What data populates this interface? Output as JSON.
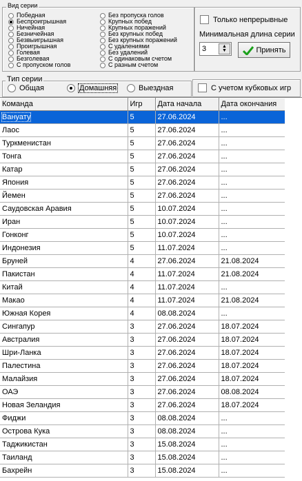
{
  "series_type": {
    "legend": "Вид серии",
    "options_left": [
      "Победная",
      "Беспроигрышная",
      "Ничейная",
      "Безничейная",
      "Безвыигрышная",
      "Проигрышная",
      "Голевая",
      "Безголевая",
      "С пропуском голов"
    ],
    "options_right": [
      "Без пропуска голов",
      "Крупных побед",
      "Крупных поражений",
      "Без крупных побед",
      "Без крупных поражений",
      "С удалениями",
      "Без удалений",
      "С одинаковым счетом",
      "С разным счетом"
    ],
    "selected": "Беспроигрышная"
  },
  "continuous_label": "Только непрерывные",
  "min_length_label": "Минимальная длина серии",
  "min_length_value": "3",
  "accept_label": "Принять",
  "game_type": {
    "legend": "Тип серии",
    "options": [
      "Общая",
      "Домашняя",
      "Выездная"
    ],
    "selected": "Домашняя"
  },
  "cup_games_label": "С учетом кубковых игр",
  "table": {
    "headers": [
      "Команда",
      "Игр",
      "Дата начала",
      "Дата окончания"
    ],
    "rows": [
      [
        "Вануату",
        "5",
        "27.06.2024",
        "..."
      ],
      [
        "Лаос",
        "5",
        "27.06.2024",
        "..."
      ],
      [
        "Туркменистан",
        "5",
        "27.06.2024",
        "..."
      ],
      [
        "Тонга",
        "5",
        "27.06.2024",
        "..."
      ],
      [
        "Катар",
        "5",
        "27.06.2024",
        "..."
      ],
      [
        "Япония",
        "5",
        "27.06.2024",
        "..."
      ],
      [
        "Йемен",
        "5",
        "27.06.2024",
        "..."
      ],
      [
        "Саудовская Аравия",
        "5",
        "10.07.2024",
        "..."
      ],
      [
        "Иран",
        "5",
        "10.07.2024",
        "..."
      ],
      [
        "Гонконг",
        "5",
        "10.07.2024",
        "..."
      ],
      [
        "Индонезия",
        "5",
        "11.07.2024",
        "..."
      ],
      [
        "Бруней",
        "4",
        "27.06.2024",
        "21.08.2024"
      ],
      [
        "Пакистан",
        "4",
        "11.07.2024",
        "21.08.2024"
      ],
      [
        "Китай",
        "4",
        "11.07.2024",
        "..."
      ],
      [
        "Макао",
        "4",
        "11.07.2024",
        "21.08.2024"
      ],
      [
        "Южная Корея",
        "4",
        "08.08.2024",
        "..."
      ],
      [
        "Сингапур",
        "3",
        "27.06.2024",
        "18.07.2024"
      ],
      [
        "Австралия",
        "3",
        "27.06.2024",
        "18.07.2024"
      ],
      [
        "Шри-Ланка",
        "3",
        "27.06.2024",
        "18.07.2024"
      ],
      [
        "Палестина",
        "3",
        "27.06.2024",
        "18.07.2024"
      ],
      [
        "Малайзия",
        "3",
        "27.06.2024",
        "18.07.2024"
      ],
      [
        "ОАЭ",
        "3",
        "27.06.2024",
        "08.08.2024"
      ],
      [
        "Новая Зеландия",
        "3",
        "27.06.2024",
        "18.07.2024"
      ],
      [
        "Фиджи",
        "3",
        "08.08.2024",
        "..."
      ],
      [
        "Острова Кука",
        "3",
        "08.08.2024",
        "..."
      ],
      [
        "Таджикистан",
        "3",
        "15.08.2024",
        "..."
      ],
      [
        "Таиланд",
        "3",
        "15.08.2024",
        "..."
      ],
      [
        "Бахрейн",
        "3",
        "15.08.2024",
        "..."
      ]
    ],
    "selected_row": 0
  },
  "colors": {
    "selection": "#0a64d8",
    "accept_check": "#1aa01a"
  },
  "icons": {
    "accept": "checkmark-icon",
    "spinner": "spin-arrows-icon"
  }
}
